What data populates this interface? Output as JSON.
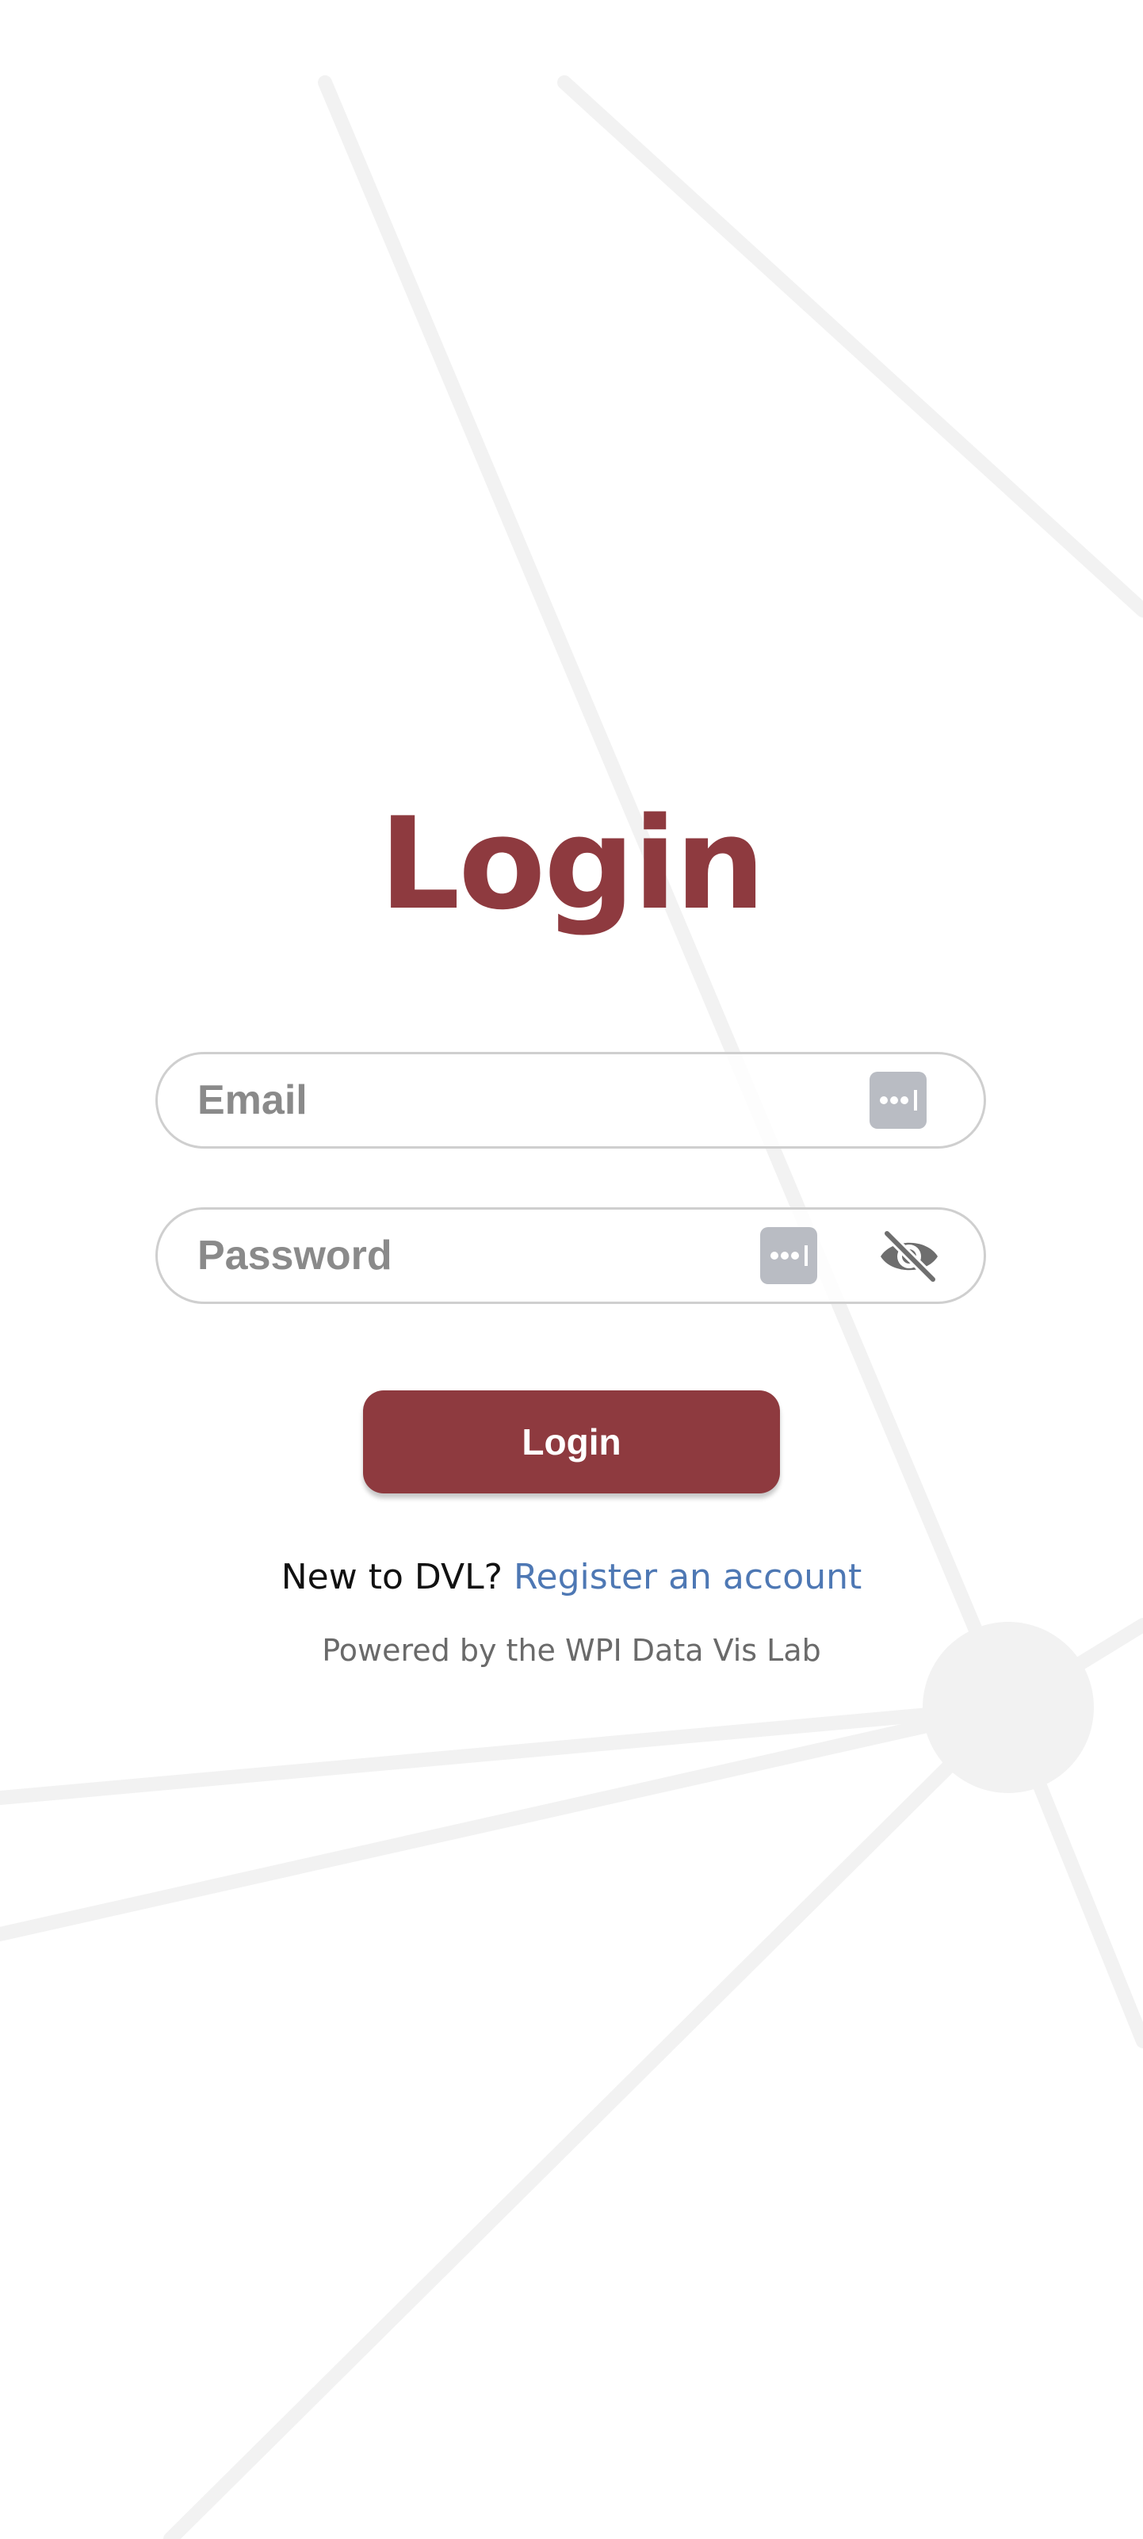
{
  "login": {
    "title": "Login",
    "email_placeholder": "Email",
    "password_placeholder": "Password",
    "submit_label": "Login",
    "register_prompt": "New to DVL?",
    "register_link": "Register an account",
    "powered_by": "Powered by the WPI Data Vis Lab"
  },
  "colors": {
    "brand": "#8e3a3f",
    "link": "#4e78b4",
    "input_border": "#cfcfcf",
    "key_badge": "#b9bcc3",
    "background_lines": "#f2f2f2"
  },
  "icons": {
    "email_field": "password-autofill-key-icon",
    "password_field": "password-autofill-key-icon",
    "password_toggle": "eye-slash-icon"
  }
}
